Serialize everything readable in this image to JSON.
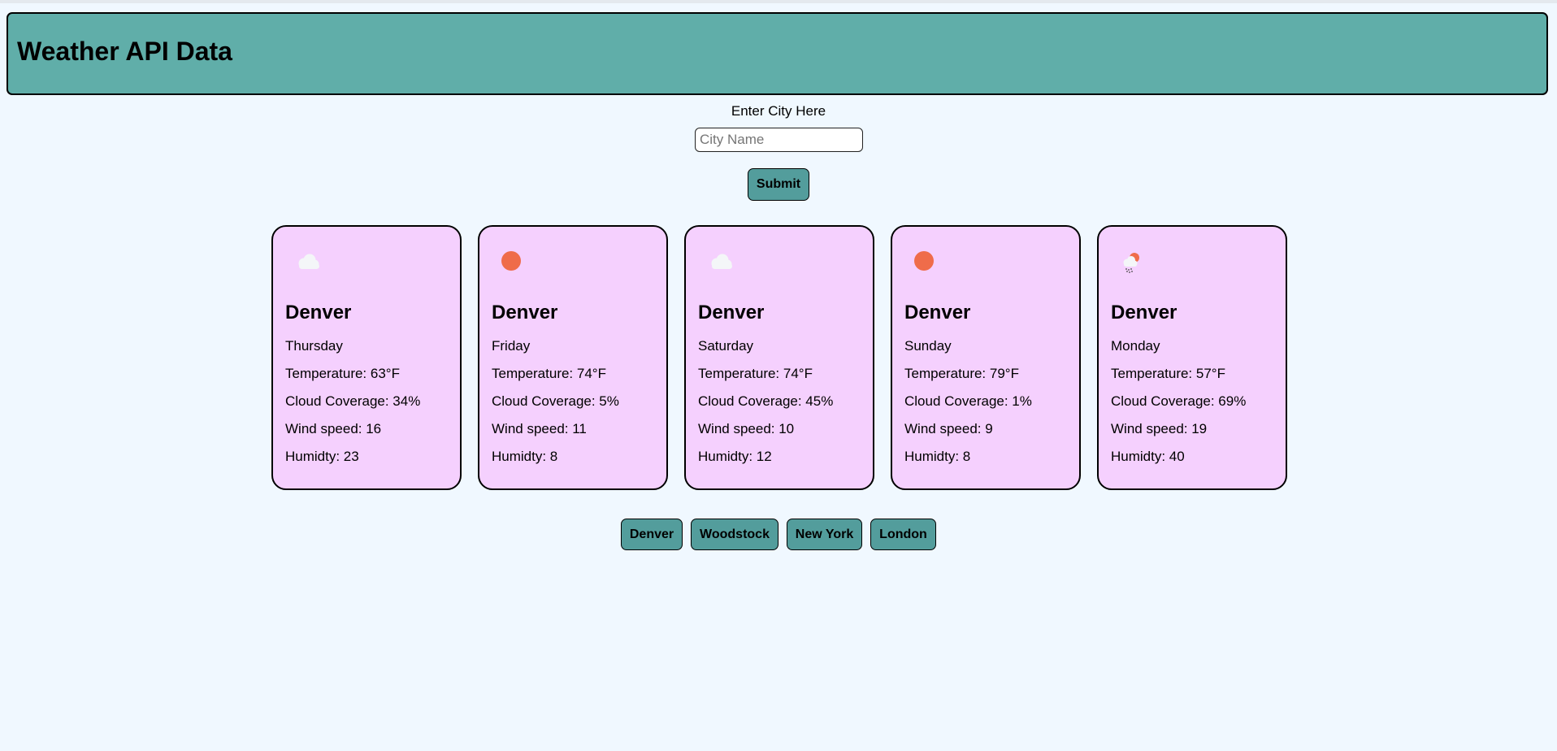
{
  "header": {
    "title": "Weather API Data"
  },
  "search": {
    "label": "Enter City Here",
    "placeholder": "City Name",
    "value": "",
    "submit_label": "Submit"
  },
  "forecast": [
    {
      "icon": "cloud-icon",
      "city": "Denver",
      "day": "Thursday",
      "temperature": "Temperature: 63°F",
      "cloud": "Cloud Coverage: 34%",
      "wind": "Wind speed: 16",
      "humidity": "Humidty: 23"
    },
    {
      "icon": "sun-icon",
      "city": "Denver",
      "day": "Friday",
      "temperature": "Temperature: 74°F",
      "cloud": "Cloud Coverage: 5%",
      "wind": "Wind speed: 11",
      "humidity": "Humidty: 8"
    },
    {
      "icon": "cloud-icon",
      "city": "Denver",
      "day": "Saturday",
      "temperature": "Temperature: 74°F",
      "cloud": "Cloud Coverage: 45%",
      "wind": "Wind speed: 10",
      "humidity": "Humidty: 12"
    },
    {
      "icon": "sun-icon",
      "city": "Denver",
      "day": "Sunday",
      "temperature": "Temperature: 79°F",
      "cloud": "Cloud Coverage: 1%",
      "wind": "Wind speed: 9",
      "humidity": "Humidty: 8"
    },
    {
      "icon": "sun-cloud-rain-icon",
      "city": "Denver",
      "day": "Monday",
      "temperature": "Temperature: 57°F",
      "cloud": "Cloud Coverage: 69%",
      "wind": "Wind speed: 19",
      "humidity": "Humidty: 40"
    }
  ],
  "history": [
    {
      "label": "Denver"
    },
    {
      "label": "Woodstock"
    },
    {
      "label": "New York"
    },
    {
      "label": "London"
    }
  ],
  "colors": {
    "page_bg": "#f0f8ff",
    "header_bg": "#60aea9",
    "button_bg": "#539d9c",
    "card_bg": "#f5d0fe",
    "sun": "#ef6c4a"
  }
}
